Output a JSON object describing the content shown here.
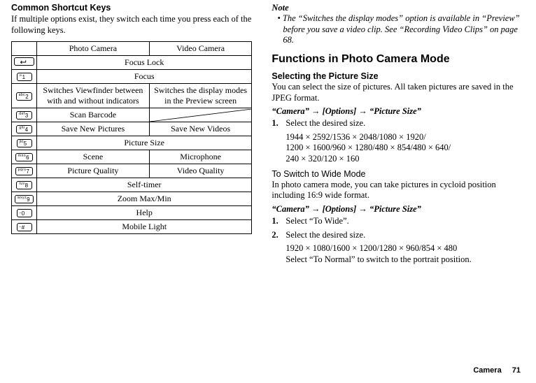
{
  "left": {
    "heading": "Common Shortcut Keys",
    "intro": "If multiple options exist, they switch each time you press each of the following keys.",
    "table": {
      "header": {
        "photo": "Photo Camera",
        "video": "Video Camera"
      },
      "rows": [
        {
          "key": "return",
          "merged": "Focus Lock"
        },
        {
          "key": "1",
          "merged": "Focus"
        },
        {
          "key": "2",
          "photo": "Switches Viewfinder between with and without indicators",
          "video": "Switches the display modes in the Preview screen"
        },
        {
          "key": "3",
          "photo": "Scan Barcode",
          "video": "__diag__"
        },
        {
          "key": "4",
          "photo": "Save New Pictures",
          "video": "Save New Videos"
        },
        {
          "key": "5",
          "merged": "Picture Size"
        },
        {
          "key": "6",
          "photo": "Scene",
          "video": "Microphone"
        },
        {
          "key": "7",
          "photo": "Picture Quality",
          "video": "Video Quality"
        },
        {
          "key": "8",
          "merged": "Self-timer"
        },
        {
          "key": "9",
          "merged": "Zoom Max/Min"
        },
        {
          "key": "0",
          "merged": "Help"
        },
        {
          "key": "#",
          "merged": "Mobile Light"
        }
      ]
    }
  },
  "right": {
    "note_head": "Note",
    "note_body": "• The “Switches the display modes” option is available in “Preview” before you save a video clip. See “Recording Video Clips” on page 68.",
    "h2": "Functions in Photo Camera Mode",
    "sec1": {
      "h3": "Selecting the Picture Size",
      "p": "You can select the size of pictures. All taken pictures are saved in the JPEG format.",
      "path": "“Camera” → [Options] → “Picture Size”",
      "step1_num": "1.",
      "step1": "Select the desired size.",
      "sizes": "1944 × 2592/1536 × 2048/1080 × 1920/\n1200 × 1600/960 × 1280/480 × 854/480 × 640/\n240 × 320/120 × 160"
    },
    "sec2": {
      "h4": "To Switch to Wide Mode",
      "p": "In photo camera mode, you can take pictures in cycloid position including 16:9 wide format.",
      "path": "“Camera” → [Options] → “Picture Size”",
      "step1_num": "1.",
      "step1": "Select “To Wide”.",
      "step2_num": "2.",
      "step2": "Select the desired size.",
      "sizes": "1920 × 1080/1600 × 1200/1280 × 960/854 × 480\nSelect “To Normal” to switch to the portrait position."
    }
  },
  "footer": {
    "section": "Camera",
    "page": "71"
  }
}
